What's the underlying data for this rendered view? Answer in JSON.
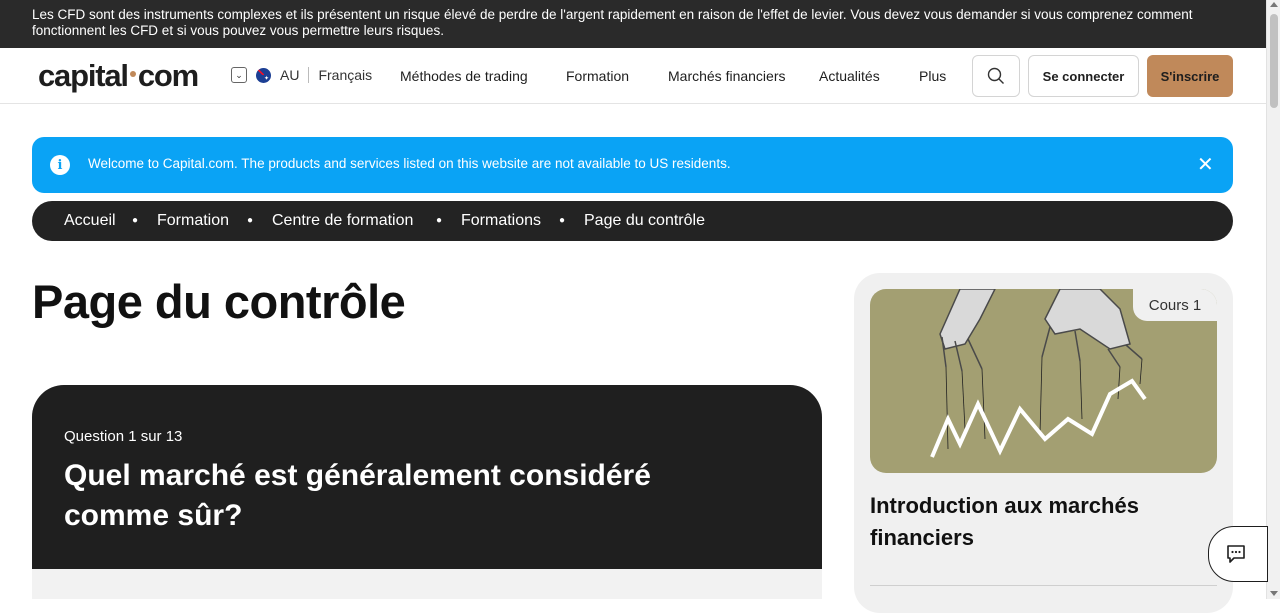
{
  "risk_warning": "Les CFD sont des instruments complexes et ils présentent un risque élevé de perdre de l'argent rapidement en raison de l'effet de levier. Vous devez vous demander si vous comprenez comment fonctionnent les CFD et si vous pouvez vous permettre leurs risques.",
  "header": {
    "logo_left": "capital",
    "logo_right": "com",
    "region": "AU",
    "language": "Français",
    "nav": [
      "Méthodes de trading",
      "Formation",
      "Marchés financiers",
      "Actualités",
      "Plus"
    ],
    "login_label": "Se connecter",
    "signup_label": "S'inscrire"
  },
  "info_banner": {
    "message": "Welcome to Capital.com. The products and services listed on this website are not available to US residents.",
    "close": "✕"
  },
  "breadcrumb": [
    "Accueil",
    "Formation",
    "Centre de formation",
    "Formations",
    "Page du contrôle"
  ],
  "page_title": "Page du contrôle",
  "quiz": {
    "question_number": "Question 1 sur 13",
    "question": "Quel marché est généralement considéré comme sûr?"
  },
  "side_card": {
    "tag": "Cours 1",
    "title": "Introduction aux marchés financiers"
  },
  "colors": {
    "accent": "#c0895a",
    "info": "#0aa3f5",
    "dark": "#1f1f1f"
  }
}
